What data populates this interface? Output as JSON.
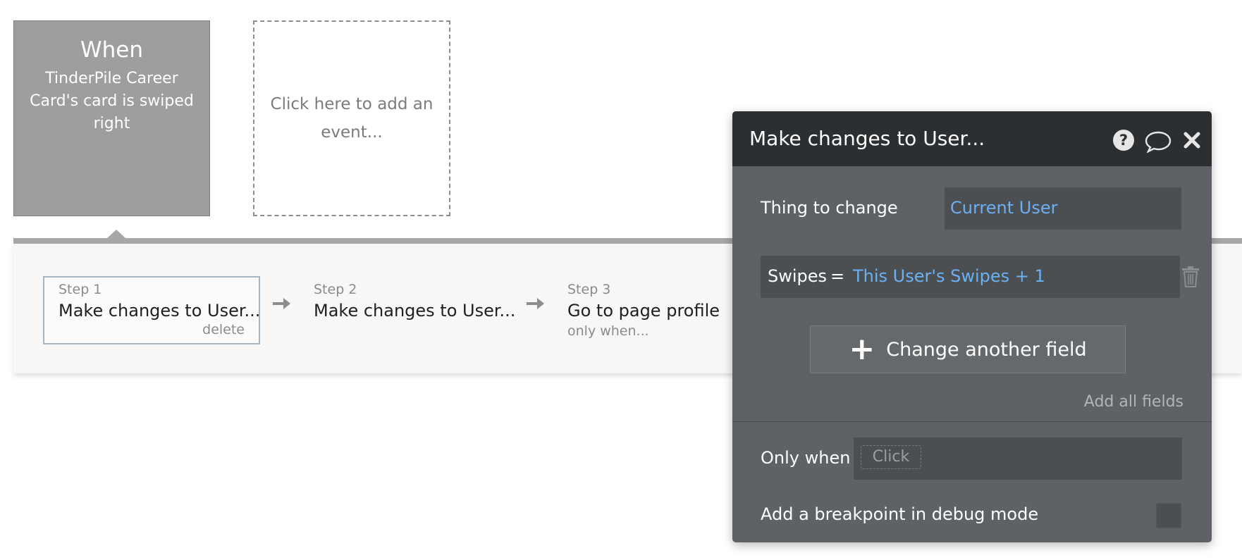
{
  "event_card": {
    "title": "When",
    "description": "TinderPile Career Card's card is swiped right"
  },
  "add_event": {
    "label": "Click here to add an event..."
  },
  "steps": [
    {
      "number": "Step 1",
      "title": "Make changes to User...",
      "action": "delete",
      "selected": true
    },
    {
      "number": "Step 2",
      "title": "Make changes to User...",
      "action": "",
      "selected": false
    },
    {
      "number": "Step 3",
      "title": "Go to page profile",
      "action": "only when...",
      "selected": false
    }
  ],
  "panel": {
    "title": "Make changes to User...",
    "icons": [
      "help-icon",
      "comment-icon",
      "close-icon"
    ],
    "thing_to_change": {
      "label": "Thing to change",
      "value": "Current User"
    },
    "field_change": {
      "field": "Swipes",
      "operator": "=",
      "value": "This User's Swipes + 1"
    },
    "change_another_field": "Change another field",
    "add_all_fields": "Add all fields",
    "only_when": {
      "label": "Only when",
      "placeholder": "Click"
    },
    "breakpoint": {
      "label": "Add a breakpoint in debug mode",
      "checked": false
    }
  },
  "colors": {
    "panel_bg": "#5e6266",
    "panel_header": "#2b2f31",
    "link": "#6ab0f3",
    "event_card": "#9e9e9e"
  }
}
